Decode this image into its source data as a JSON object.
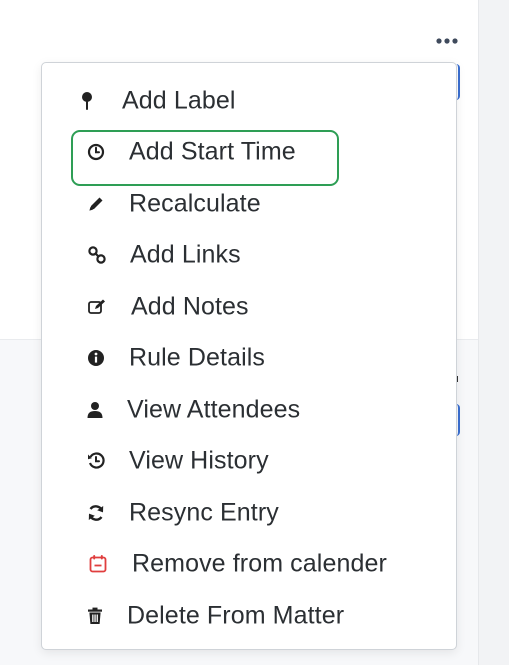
{
  "header": {
    "more_icon": "more-horizontal-icon"
  },
  "menu": {
    "highlighted_item": "Add Start Time",
    "accent_highlight_color": "#2e9e55",
    "danger_icon_color": "#e03e3e",
    "items": [
      {
        "label": "Add Label",
        "icon": "pin-icon"
      },
      {
        "label": "Add Start Time",
        "icon": "clock-icon"
      },
      {
        "label": "Recalculate",
        "icon": "pencil-icon"
      },
      {
        "label": "Add Links",
        "icon": "link-icon"
      },
      {
        "label": "Add Notes",
        "icon": "edit-note-icon"
      },
      {
        "label": "Rule Details",
        "icon": "info-circle-icon"
      },
      {
        "label": "View Attendees",
        "icon": "user-icon"
      },
      {
        "label": "View History",
        "icon": "history-icon"
      },
      {
        "label": "Resync Entry",
        "icon": "sync-icon"
      },
      {
        "label": "Remove from calender",
        "icon": "calendar-remove-icon"
      },
      {
        "label": "Delete From Matter",
        "icon": "trash-icon"
      }
    ]
  }
}
